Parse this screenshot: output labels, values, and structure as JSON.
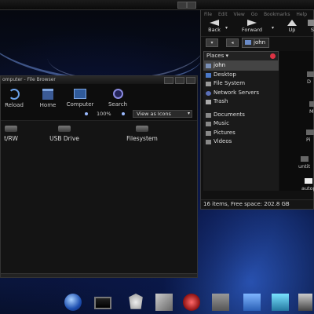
{
  "left_window": {
    "title": "omputer - File Browser",
    "toolbar": {
      "reload": "Reload",
      "home": "Home",
      "computer": "Computer",
      "search": "Search"
    },
    "zoom": "100%",
    "view_as": "View as Icons",
    "drives": [
      {
        "label": "t/RW"
      },
      {
        "label": "USB Drive"
      },
      {
        "label": "Filesystem"
      }
    ]
  },
  "right_window": {
    "menu": [
      "File",
      "Edit",
      "View",
      "Go",
      "Bookmarks",
      "Help"
    ],
    "nav": {
      "back": "Back",
      "forward": "Forward",
      "up": "Up",
      "stop": "S"
    },
    "location": "john",
    "places_header": "Places ▾",
    "places": [
      {
        "label": "john",
        "selected": true
      },
      {
        "label": "Desktop"
      },
      {
        "label": "File System"
      },
      {
        "label": "Network Servers"
      },
      {
        "label": "Trash"
      }
    ],
    "bookmarks": [
      {
        "label": "Documents"
      },
      {
        "label": "Music"
      },
      {
        "label": "Pictures"
      },
      {
        "label": "Videos"
      }
    ],
    "main_items": [
      {
        "label": "D"
      },
      {
        "label": "M"
      },
      {
        "label": "Pi"
      },
      {
        "label": "untit"
      },
      {
        "label": "autop"
      }
    ],
    "status": "16 items, Free space: 202.8 GB"
  },
  "dock": {
    "items": [
      "blue-orb-icon",
      "monitor-icon",
      "gnu-icon",
      "files-icon",
      "red-disc-icon",
      "text-editor-icon",
      "blue-box-icon",
      "teal-icon",
      "app-icon"
    ]
  }
}
